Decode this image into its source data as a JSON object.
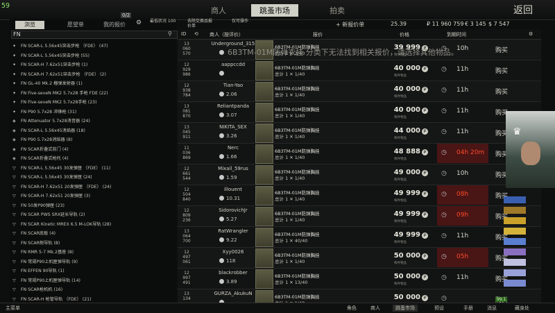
{
  "fps": "59",
  "top_tabs": [
    "商人",
    "跳蚤市场",
    "拍卖"
  ],
  "back": "返回",
  "currency": {
    "rub_badge": "25.39",
    "roubles": "₽ 11 960 759",
    "euros": "€ 3 145",
    "dollars": "$ 7 547"
  },
  "subtabs": {
    "browse": "浏览",
    "wishlist": "愿望单",
    "my_offers": "我的报价",
    "count": "0/2"
  },
  "filters": {
    "f1": "最低状况 100",
    "f2": "去除交换品报价单",
    "f3": "仅可操作"
  },
  "search": {
    "value": "FN"
  },
  "tree": [
    {
      "icon": "gun",
      "label": "FN SCAR-L 5.56x45突击步枪 （FDE） (47)"
    },
    {
      "icon": "gun",
      "label": "FN SCAR-L 5.56x45突击步枪 (55)"
    },
    {
      "icon": "gun",
      "label": "FN SCAR-H 7.62x51突击步枪 (1)"
    },
    {
      "icon": "gun",
      "label": "FN SCAR-H 7.62x51突击步枪 （FDE） (2)"
    },
    {
      "icon": "gun",
      "label": "FN GL-40 Mk.2 榴弹发射器 (1)"
    },
    {
      "icon": "gun",
      "label": "FN Five-seveN MK2 5.7x28 手枪 FDE (22)"
    },
    {
      "icon": "gun",
      "label": "FN Five-seveN MK2 5.7x28手枪 (23)"
    },
    {
      "icon": "gun",
      "label": "FN P90 5.7x28 冲锋枪 (31)"
    },
    {
      "icon": "part",
      "label": "FN Attenuator 5.7x28消音器 (24)"
    },
    {
      "icon": "part",
      "label": "FN SCAR-L 5.56x45消焰器 (18)"
    },
    {
      "icon": "part",
      "label": "FN P90 5.7x28消焰器 (8)"
    },
    {
      "icon": "part",
      "label": "FN SCAR折叠式前门 (4)"
    },
    {
      "icon": "part",
      "label": "FN SCAR折叠式枪托 (4)"
    },
    {
      "icon": "mag",
      "label": "FN SCAR-L 5.56x45 30发弹匣 （FDE） (11)"
    },
    {
      "icon": "mag",
      "label": "FN SCAR-L 5.56x45 30发弹匣 (24)"
    },
    {
      "icon": "mag",
      "label": "FN SCAR-H 7.62x51 20发弹匣 （FDE） (24)"
    },
    {
      "icon": "mag",
      "label": "FN SCAR-H 7.62x51 20发弹匣 (3)"
    },
    {
      "icon": "mag",
      "label": "FN 50发P90弹匣 (23)"
    },
    {
      "icon": "mag",
      "label": "FN SCAR PWS SRX延长导轨 (2)"
    },
    {
      "icon": "mag",
      "label": "FN SCAR Kinetic MREX 6.5 M-LOK导轨 (28)"
    },
    {
      "icon": "mag",
      "label": "FN SCAR底板 (4)"
    },
    {
      "icon": "mag",
      "label": "FN SCAR侧导轨 (8)"
    },
    {
      "icon": "mag",
      "label": "FN RMR 5-7 Mk.2基座 (8)"
    },
    {
      "icon": "mag",
      "label": "FN 常规P90上机匣弹导轨 (9)"
    },
    {
      "icon": "mag",
      "label": "FN EFFEN 90导轨 (1)"
    },
    {
      "icon": "mag",
      "label": "FN 常规P90上机匣弹导轨 (14)"
    },
    {
      "icon": "mag",
      "label": "FN SCAR枪机机 (16)"
    },
    {
      "icon": "mag",
      "label": "FN SCAR-H 枪管导轨 （FDE） (21)"
    }
  ],
  "table_header": {
    "id": "ID",
    "seller": "商人（按评价）",
    "offer": "报价",
    "price": "价格",
    "expires": "到期时间",
    "add_btn": "+ 新报价单"
  },
  "overlay_msg": "6B3TM-01M防弹衣挂 分类下无法找到相关报价，请选择其他物品。",
  "item_name": "6B3TM-01M防弹胸挂",
  "price_sub": "每件物品",
  "buy_label": "购买",
  "rows": [
    {
      "id": "13\n060\n570",
      "seller": "Underground_315",
      "rating": "",
      "qty": "总计 1  ✕ 2/40",
      "price": "39 999",
      "exp": "10h",
      "red": false
    },
    {
      "id": "12\n929\n986",
      "seller": "aappccdd",
      "rating": "",
      "qty": "总计 1  ✕ 1/40",
      "price": "40 000",
      "exp": "11h",
      "red": false
    },
    {
      "id": "12\n938\n784",
      "seller": "Tian-Yao",
      "rating": "2.06",
      "qty": "总计 1  ✕ 1/40",
      "price": "40 000",
      "exp": "11h",
      "red": false
    },
    {
      "id": "13\n081\n870",
      "seller": "Reliantpanda",
      "rating": "3.07",
      "qty": "总计 1  ✕ 1/40",
      "price": "40 000",
      "exp": "11h",
      "red": false
    },
    {
      "id": "13\n045\n911",
      "seller": "NIKITA_SEX",
      "rating": "3.26",
      "qty": "总计 1  ✕ 1/40",
      "price": "44 000",
      "exp": "11h",
      "red": false
    },
    {
      "id": "11\n036\n869",
      "seller": "Nerc",
      "rating": "1.66",
      "qty": "总计 1  ✕ 1/40",
      "price": "48 888",
      "exp": "04h 20m",
      "red": true
    },
    {
      "id": "12\n661\n544",
      "seller": "Mixail_59rus",
      "rating": "1.59",
      "qty": "总计 1  ✕ 1/40",
      "price": "49 000",
      "exp": "10h",
      "red": false
    },
    {
      "id": "12\n504\n840",
      "seller": "illouent",
      "rating": "10.31",
      "qty": "总计 1  ✕ 1/40",
      "price": "49 999",
      "exp": "08h",
      "red": true
    },
    {
      "id": "12\n809\n236",
      "seller": "SidorovichJr",
      "rating": "5.27",
      "qty": "总计 1  ✕ 1/40",
      "price": "49 999",
      "exp": "09h",
      "red": true
    },
    {
      "id": "13\n064\n700",
      "seller": "RatWrangler",
      "rating": "9.22",
      "qty": "总计 1  ✕ 40/40",
      "price": "49 999",
      "exp": "11h",
      "red": false
    },
    {
      "id": "12\n497\n061",
      "seller": "Xyy0026",
      "rating": "118",
      "qty": "总计 1  ✕ 1/40",
      "price": "50 000",
      "exp": "05h",
      "red": true
    },
    {
      "id": "12\n997\n491",
      "seller": "blackrobber",
      "rating": "3.89",
      "qty": "总计 1  ✕ 13/40",
      "price": "50 000",
      "exp": "11h",
      "red": false
    },
    {
      "id": "13\n134\n",
      "seller": "GURZA_AkukuN",
      "rating": "",
      "qty": "总计 1  ✕ 1/40",
      "price": "50 000",
      "exp": "",
      "red": false
    }
  ],
  "bottom": {
    "main": "主菜单",
    "char": "角色",
    "trader": "商人",
    "flea": "跳蚤市场",
    "handbook": "手册",
    "msg": "消息",
    "hideout": "藏身处",
    "b1": "预设",
    "b2": "预设"
  },
  "side_badge": "99.1"
}
